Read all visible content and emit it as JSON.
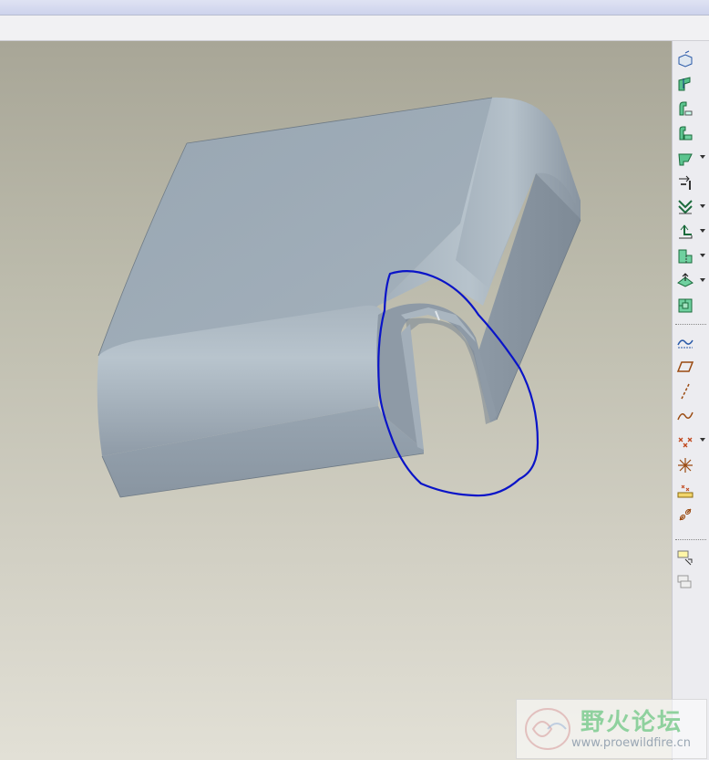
{
  "watermark": {
    "title": "野火论坛",
    "url": "www.proewildfire.cn"
  },
  "colors": {
    "viewport_top": "#a8a697",
    "viewport_bottom": "#e2e0d6",
    "part_face": "#9eacb8",
    "annotation": "#0a14c8",
    "toolbar_bg": "#ececf0"
  },
  "toolbar": {
    "items": [
      {
        "icon": "datum-plane-icon"
      },
      {
        "icon": "datum-axis-icon"
      },
      {
        "icon": "flange-wall-icon"
      },
      {
        "icon": "flat-wall-icon"
      },
      {
        "icon": "extend-wall-icon",
        "dropdown": true
      },
      {
        "icon": "unbend-icon"
      },
      {
        "icon": "bend-back-icon",
        "dropdown": true
      },
      {
        "icon": "bend-icon",
        "dropdown": true
      },
      {
        "icon": "rip-icon",
        "dropdown": true
      },
      {
        "icon": "corner-relief-icon",
        "dropdown": true
      },
      {
        "icon": "form-icon"
      },
      {
        "icon": "sketch-icon"
      },
      {
        "icon": "datum-plane-tool-icon"
      },
      {
        "icon": "datum-axis-tool-icon"
      },
      {
        "icon": "datum-curve-icon"
      },
      {
        "icon": "datum-point-icon",
        "dropdown": true
      },
      {
        "icon": "coordinate-system-icon"
      },
      {
        "icon": "analysis-icon"
      },
      {
        "icon": "chain-icon"
      },
      {
        "icon": "annotation-icon"
      },
      {
        "icon": "annotation-disabled-icon"
      }
    ]
  }
}
